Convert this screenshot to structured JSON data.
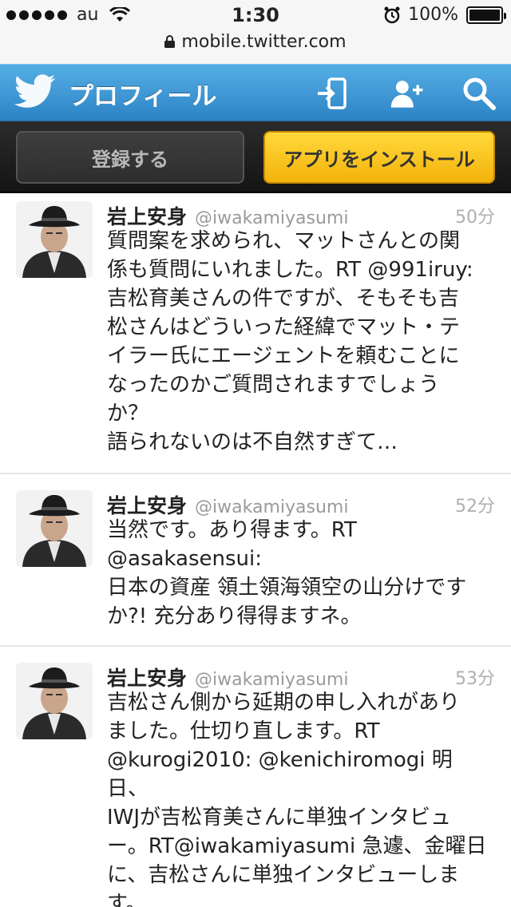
{
  "status_bar": {
    "carrier": "au",
    "time": "1:30",
    "battery": "100%"
  },
  "url_bar": {
    "url": "mobile.twitter.com"
  },
  "header": {
    "title": "プロフィール",
    "icons": [
      "twitter-bird-icon",
      "login-icon",
      "add-user-icon",
      "search-icon"
    ]
  },
  "signup": {
    "register_label": "登録する",
    "install_label": "アプリをインストール"
  },
  "tweets": [
    {
      "name": "岩上安身",
      "handle": "@iwakamiyasumi",
      "time": "50分",
      "text": "質問案を求められ、マットさんとの関\n係も質問にいれました。RT @991iruy:\n吉松育美さんの件ですが、そもそも吉\n松さんはどういった経緯でマット・テ\nイラー氏にエージェントを頼むことに\nなったのかご質問されますでしょう\nか？\n語られないのは不自然すぎて…"
    },
    {
      "name": "岩上安身",
      "handle": "@iwakamiyasumi",
      "time": "52分",
      "text": "当然です。あり得ます。RT\n@asakasensui:\n日本の資産 領土領海領空の山分けです\nか?! 充分あり得得ますネ。"
    },
    {
      "name": "岩上安身",
      "handle": "@iwakamiyasumi",
      "time": "53分",
      "text": "吉松さん側から延期の申し入れがあり\nました。仕切り直します。RT\n@kurogi2010: @kenichiromogi 明日、\nIWJが吉松育美さんに単独インタビュ\nー。RT@iwakamiyasumi 急遽、金曜日\nに、吉松さんに単独インタビューしま\nす。"
    }
  ],
  "colors": {
    "header_blue": "#3a95d6",
    "install_yellow": "#f7c21c",
    "dark_bar": "#1e1e1e"
  }
}
